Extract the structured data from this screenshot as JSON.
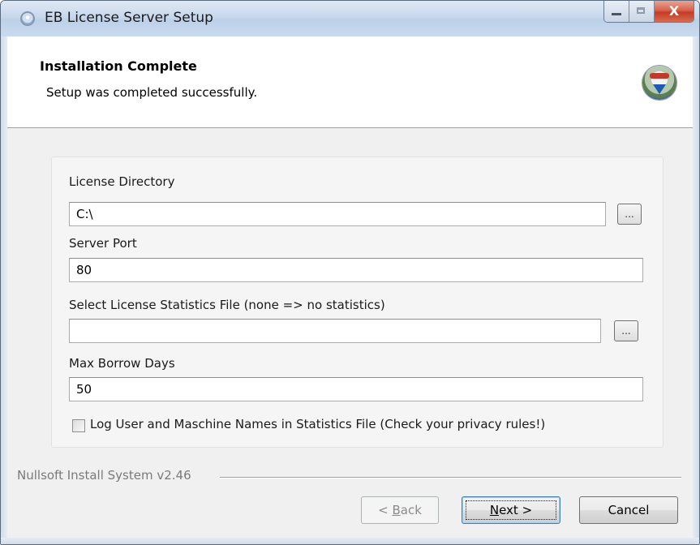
{
  "window": {
    "title": "EB License Server Setup",
    "close_glyph": "X",
    "icons": {
      "app": "setup-globe-icon",
      "minimize": "minimize-icon",
      "maximize": "maximize-icon",
      "close": "close-icon"
    }
  },
  "header": {
    "title": "Installation Complete",
    "subtitle": "Setup was completed successfully.",
    "logo_icon": "installer-globe-icon"
  },
  "form": {
    "license_directory": {
      "label": "License Directory",
      "value": "C:\\",
      "browse_label": "..."
    },
    "server_port": {
      "label": "Server Port",
      "value": "80"
    },
    "statistics_file": {
      "label": "Select License Statistics File (none => no statistics)",
      "value": "",
      "browse_label": "..."
    },
    "max_borrow_days": {
      "label": "Max Borrow Days",
      "value": "50"
    },
    "log_names": {
      "label": "Log User and Maschine Names in Statistics File (Check your privacy rules!)",
      "checked": false
    }
  },
  "footer": {
    "branding": "Nullsoft Install System v2.46",
    "back": {
      "prefix": "< ",
      "mnemonic": "B",
      "rest": "ack"
    },
    "next": {
      "mnemonic": "N",
      "rest": "ext >"
    },
    "cancel": "Cancel"
  }
}
